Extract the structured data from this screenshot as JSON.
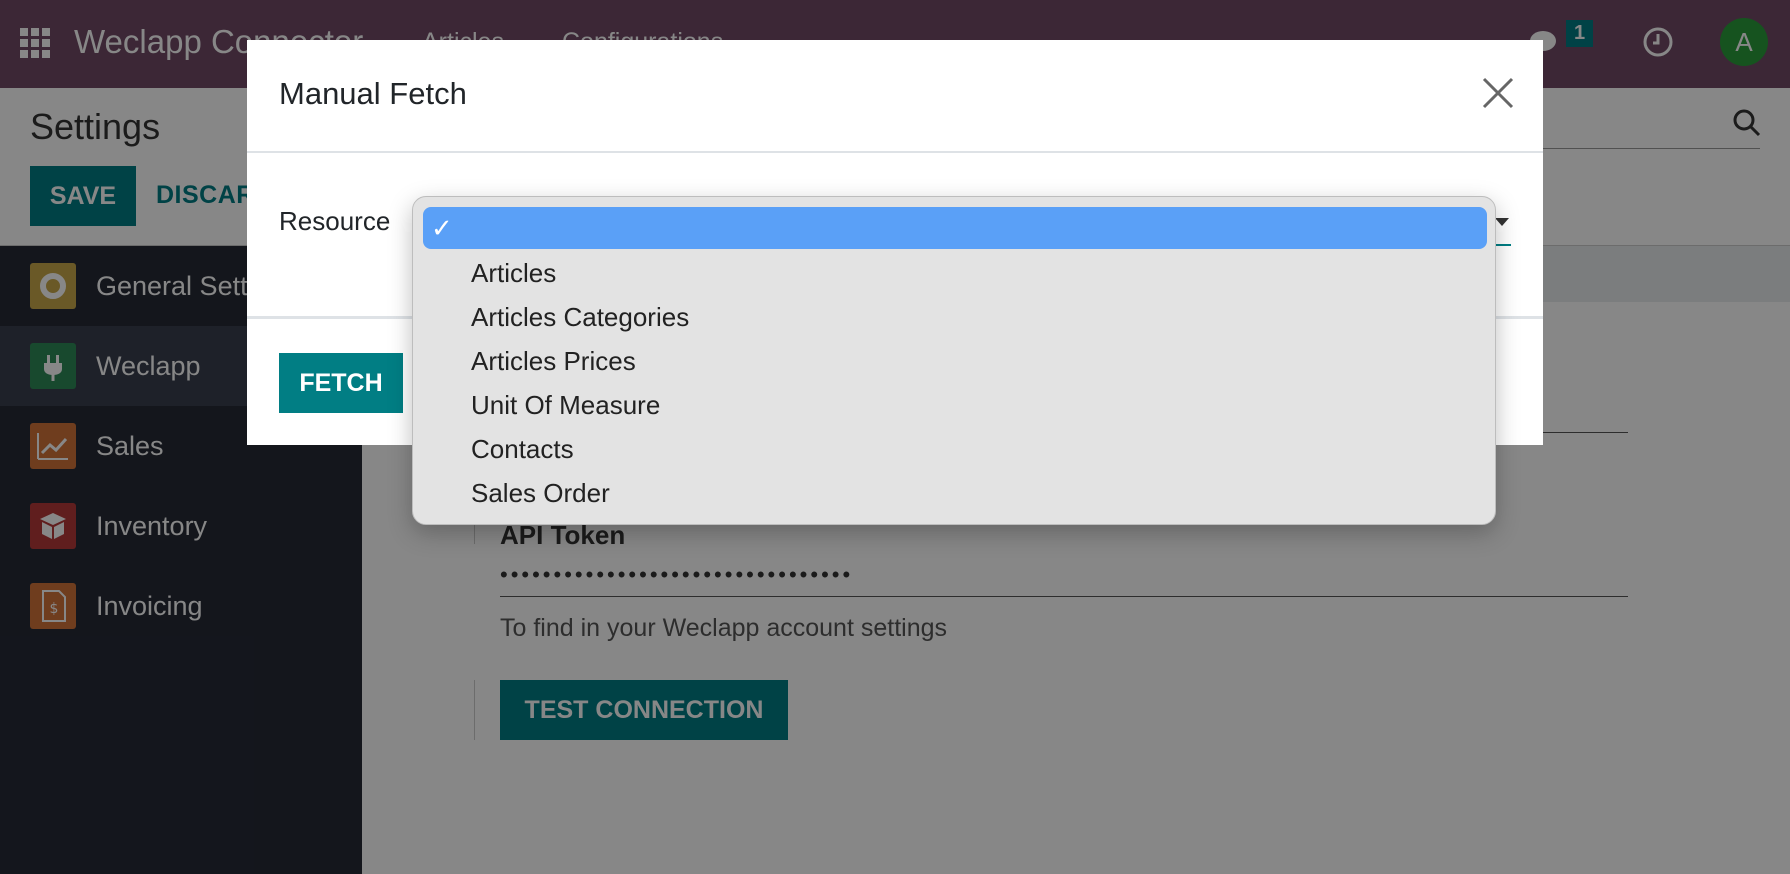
{
  "navbar": {
    "brand": "Weclapp Connector",
    "menu": [
      "Articles",
      "Configurations"
    ],
    "chat_count": "1",
    "avatar_initial": "A"
  },
  "control_panel": {
    "title": "Settings",
    "save_label": "SAVE",
    "discard_label": "DISCARD"
  },
  "sidebar": {
    "items": [
      {
        "label": "General Settings",
        "icon": "gear-icon",
        "color": "#c9a94a"
      },
      {
        "label": "Weclapp",
        "icon": "plug-icon",
        "color": "#2e8b57"
      },
      {
        "label": "Sales",
        "icon": "chart-up-icon",
        "color": "#d2733a"
      },
      {
        "label": "Inventory",
        "icon": "box-icon",
        "color": "#b53a3a"
      },
      {
        "label": "Invoicing",
        "icon": "invoice-icon",
        "color": "#d2733a"
      }
    ]
  },
  "main": {
    "api_label": "API Token",
    "api_value": "•••••••••••••••••••••••••••••••••",
    "api_help": "To find in your Weclapp account settings",
    "test_label": "TEST CONNECTION"
  },
  "modal": {
    "title": "Manual Fetch",
    "resource_label": "Resource",
    "fetch_label": "FETCH"
  },
  "dropdown": {
    "selected_check": "✓",
    "options": [
      "",
      "Articles",
      "Articles Categories",
      "Articles Prices",
      "Unit Of Measure",
      "Contacts",
      "Sales Order"
    ]
  },
  "colors": {
    "navbar": "#714b67",
    "accent": "#017e84",
    "sidebar_bg": "#262a36",
    "selected_option": "#5aa0f7"
  }
}
